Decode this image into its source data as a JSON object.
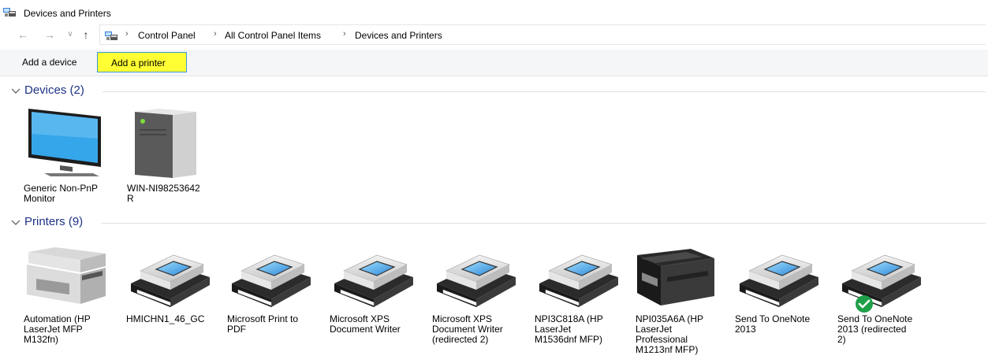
{
  "window": {
    "title": "Devices and Printers"
  },
  "navigation": {
    "back_icon": "arrow-left-icon",
    "forward_icon": "arrow-right-icon",
    "recent_icon": "chevron-down-icon",
    "up_icon": "arrow-up-icon",
    "breadcrumbs": [
      "Control Panel",
      "All Control Panel Items",
      "Devices and Printers"
    ]
  },
  "commands": {
    "add_device": "Add a device",
    "add_printer": "Add a printer"
  },
  "colors": {
    "group_title": "#1e3287",
    "highlight": "#ffff33",
    "check": "#1ea048"
  },
  "devices": {
    "title": "Devices (2)",
    "items": [
      {
        "label": "Generic Non-PnP\nMonitor",
        "icon": "monitor-icon"
      },
      {
        "label": "WIN-NI98253642\nR",
        "icon": "computer-tower-icon"
      }
    ]
  },
  "printers": {
    "title": "Printers (9)",
    "items": [
      {
        "label": "Automation (HP\nLaserJet MFP\nM132fn)",
        "icon": "mfp-printer-icon"
      },
      {
        "label": "HMICHN1_46_GC",
        "icon": "printer-icon"
      },
      {
        "label": "Microsoft Print to\nPDF",
        "icon": "printer-icon"
      },
      {
        "label": "Microsoft XPS\nDocument Writer",
        "icon": "printer-icon"
      },
      {
        "label": "Microsoft XPS\nDocument Writer\n(redirected 2)",
        "icon": "printer-icon"
      },
      {
        "label": "NPI3C818A (HP\nLaserJet\nM1536dnf MFP)",
        "icon": "printer-icon"
      },
      {
        "label": "NPI035A6A (HP\nLaserJet\nProfessional\nM1213nf MFP)",
        "icon": "black-mfp-printer-icon"
      },
      {
        "label": "Send To OneNote\n2013",
        "icon": "printer-icon"
      },
      {
        "label": "Send To OneNote\n2013 (redirected\n2)",
        "icon": "printer-icon",
        "default": true
      }
    ]
  }
}
